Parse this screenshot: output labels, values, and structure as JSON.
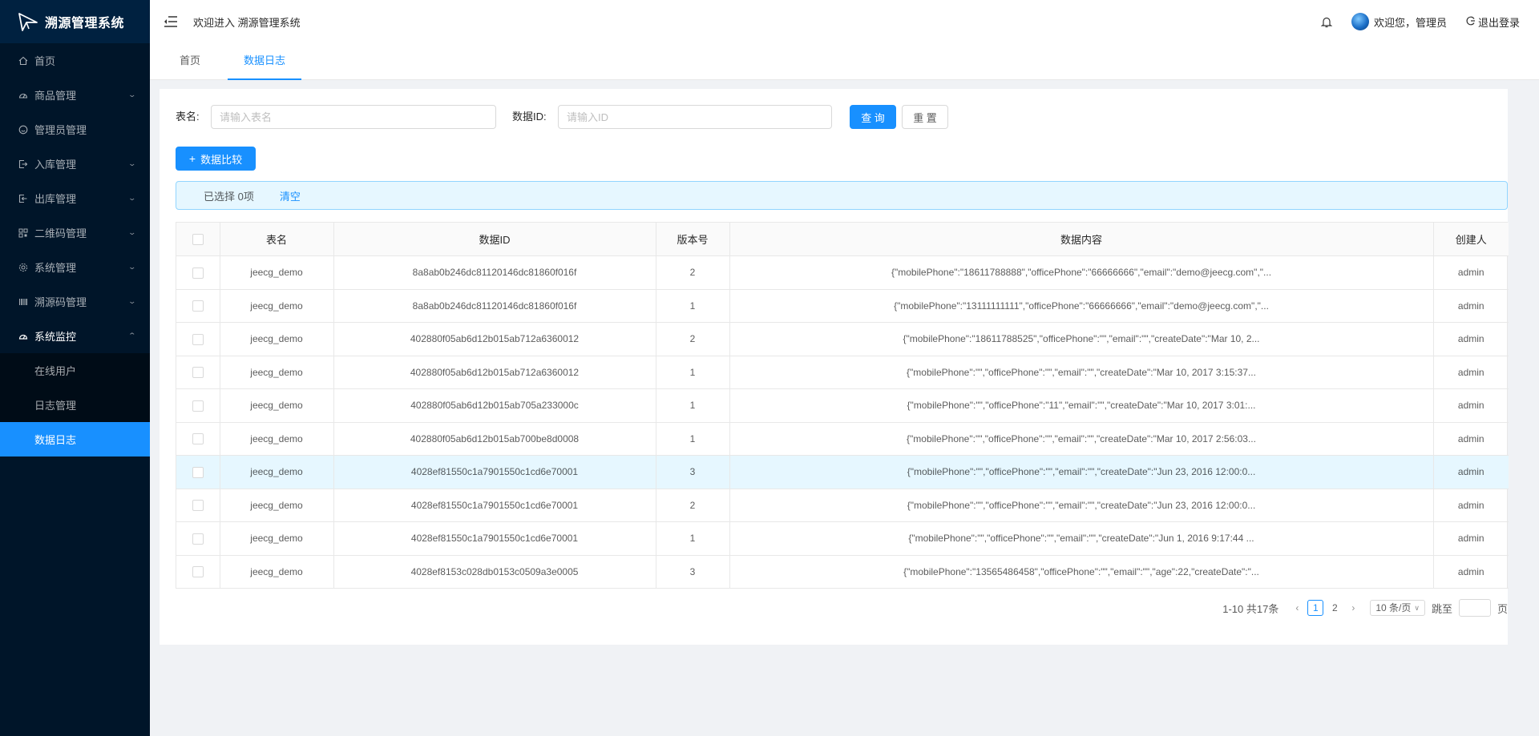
{
  "app": {
    "title": "溯源管理系统"
  },
  "sidebar": {
    "items": [
      {
        "label": "首页",
        "icon": "home-icon"
      },
      {
        "label": "商品管理",
        "icon": "dashboard-icon"
      },
      {
        "label": "管理员管理",
        "icon": "smile-icon"
      },
      {
        "label": "入库管理",
        "icon": "import-icon"
      },
      {
        "label": "出库管理",
        "icon": "export-icon"
      },
      {
        "label": "二维码管理",
        "icon": "qrcode-icon"
      },
      {
        "label": "系统管理",
        "icon": "setting-icon"
      },
      {
        "label": "溯源码管理",
        "icon": "barcode-icon"
      },
      {
        "label": "系统监控",
        "icon": "monitor-icon"
      }
    ],
    "submenu": [
      {
        "label": "在线用户"
      },
      {
        "label": "日志管理"
      },
      {
        "label": "数据日志"
      }
    ]
  },
  "header": {
    "welcome": "欢迎进入 溯源管理系统",
    "user_greeting": "欢迎您，管理员",
    "logout": "退出登录"
  },
  "tabs": [
    {
      "label": "首页"
    },
    {
      "label": "数据日志"
    }
  ],
  "search": {
    "table_label": "表名:",
    "table_placeholder": "请输入表名",
    "id_label": "数据ID:",
    "id_placeholder": "请输入ID",
    "query_button": "查 询",
    "reset_button": "重 置"
  },
  "compare_button": "数据比较",
  "alert": {
    "selected": "已选择 0项",
    "clear": "清空"
  },
  "table": {
    "columns": [
      "表名",
      "数据ID",
      "版本号",
      "数据内容",
      "创建人"
    ],
    "rows": [
      {
        "table": "jeecg_demo",
        "id": "8a8ab0b246dc81120146dc81860f016f",
        "version": "2",
        "content": "{\"mobilePhone\":\"18611788888\",\"officePhone\":\"66666666\",\"email\":\"demo@jeecg.com\",\"...",
        "creator": "admin"
      },
      {
        "table": "jeecg_demo",
        "id": "8a8ab0b246dc81120146dc81860f016f",
        "version": "1",
        "content": "{\"mobilePhone\":\"13111111111\",\"officePhone\":\"66666666\",\"email\":\"demo@jeecg.com\",\"...",
        "creator": "admin"
      },
      {
        "table": "jeecg_demo",
        "id": "402880f05ab6d12b015ab712a6360012",
        "version": "2",
        "content": "{\"mobilePhone\":\"18611788525\",\"officePhone\":\"\",\"email\":\"\",\"createDate\":\"Mar 10, 2...",
        "creator": "admin"
      },
      {
        "table": "jeecg_demo",
        "id": "402880f05ab6d12b015ab712a6360012",
        "version": "1",
        "content": "{\"mobilePhone\":\"\",\"officePhone\":\"\",\"email\":\"\",\"createDate\":\"Mar 10, 2017 3:15:37...",
        "creator": "admin"
      },
      {
        "table": "jeecg_demo",
        "id": "402880f05ab6d12b015ab705a233000c",
        "version": "1",
        "content": "{\"mobilePhone\":\"\",\"officePhone\":\"11\",\"email\":\"\",\"createDate\":\"Mar 10, 2017 3:01:...",
        "creator": "admin"
      },
      {
        "table": "jeecg_demo",
        "id": "402880f05ab6d12b015ab700be8d0008",
        "version": "1",
        "content": "{\"mobilePhone\":\"\",\"officePhone\":\"\",\"email\":\"\",\"createDate\":\"Mar 10, 2017 2:56:03...",
        "creator": "admin"
      },
      {
        "table": "jeecg_demo",
        "id": "4028ef81550c1a7901550c1cd6e70001",
        "version": "3",
        "content": "{\"mobilePhone\":\"\",\"officePhone\":\"\",\"email\":\"\",\"createDate\":\"Jun 23, 2016 12:00:0...",
        "creator": "admin",
        "highlight": true
      },
      {
        "table": "jeecg_demo",
        "id": "4028ef81550c1a7901550c1cd6e70001",
        "version": "2",
        "content": "{\"mobilePhone\":\"\",\"officePhone\":\"\",\"email\":\"\",\"createDate\":\"Jun 23, 2016 12:00:0...",
        "creator": "admin"
      },
      {
        "table": "jeecg_demo",
        "id": "4028ef81550c1a7901550c1cd6e70001",
        "version": "1",
        "content": "{\"mobilePhone\":\"\",\"officePhone\":\"\",\"email\":\"\",\"createDate\":\"Jun 1, 2016 9:17:44 ...",
        "creator": "admin"
      },
      {
        "table": "jeecg_demo",
        "id": "4028ef8153c028db0153c0509a3e0005",
        "version": "3",
        "content": "{\"mobilePhone\":\"13565486458\",\"officePhone\":\"\",\"email\":\"\",\"age\":22,\"createDate\":\"...",
        "creator": "admin"
      }
    ]
  },
  "pagination": {
    "total": "1-10 共17条",
    "pages": [
      "1",
      "2"
    ],
    "current": "1",
    "page_size": "10 条/页",
    "jump_label": "跳至",
    "page_suffix": "页"
  },
  "colors": {
    "primary": "#1890ff",
    "sidebar_bg": "#001529",
    "submenu_bg": "#000c17",
    "highlight_row": "#e6f7ff"
  }
}
